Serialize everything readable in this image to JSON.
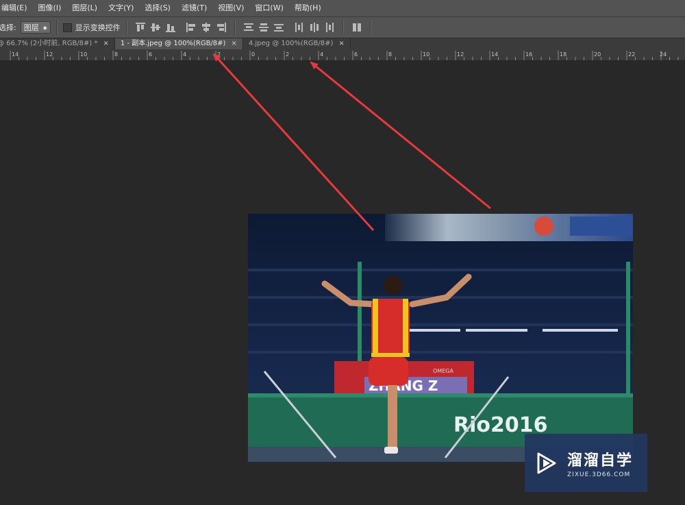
{
  "menubar": {
    "items": [
      "编辑(E)",
      "图像(I)",
      "图层(L)",
      "文字(Y)",
      "选择(S)",
      "滤镜(T)",
      "视图(V)",
      "窗口(W)",
      "帮助(H)"
    ]
  },
  "options": {
    "select_label": "选择:",
    "select_value": "图层",
    "show_transform_label": "显示变换控件"
  },
  "tabs": [
    {
      "label": "@ 66.7% (2小时前, RGB/8#) *",
      "active": false,
      "close": "×"
    },
    {
      "label": "1 - 副本.jpeg @ 100%(RGB/8#)",
      "active": true,
      "close": "×"
    },
    {
      "label": "4.jpeg @ 100%(RGB/8#)",
      "active": false,
      "close": "×"
    }
  ],
  "ruler": {
    "labels": [
      "14",
      "12",
      "10",
      "8",
      "6",
      "4",
      "2",
      "0",
      "2",
      "4",
      "6",
      "8",
      "10",
      "12",
      "14",
      "16",
      "18",
      "20",
      "22",
      "24"
    ]
  },
  "photo": {
    "bib_text": "ZHANG Z",
    "banner_text": "Rio2016",
    "board_text": "OMEGA"
  },
  "watermark": {
    "title": "溜溜自学",
    "url": "ZIXUE.3D66.COM"
  },
  "colors": {
    "accent_arrow": "#e8393c",
    "panel": "#535353",
    "canvas": "#282828",
    "watermark_bg": "#223660"
  }
}
